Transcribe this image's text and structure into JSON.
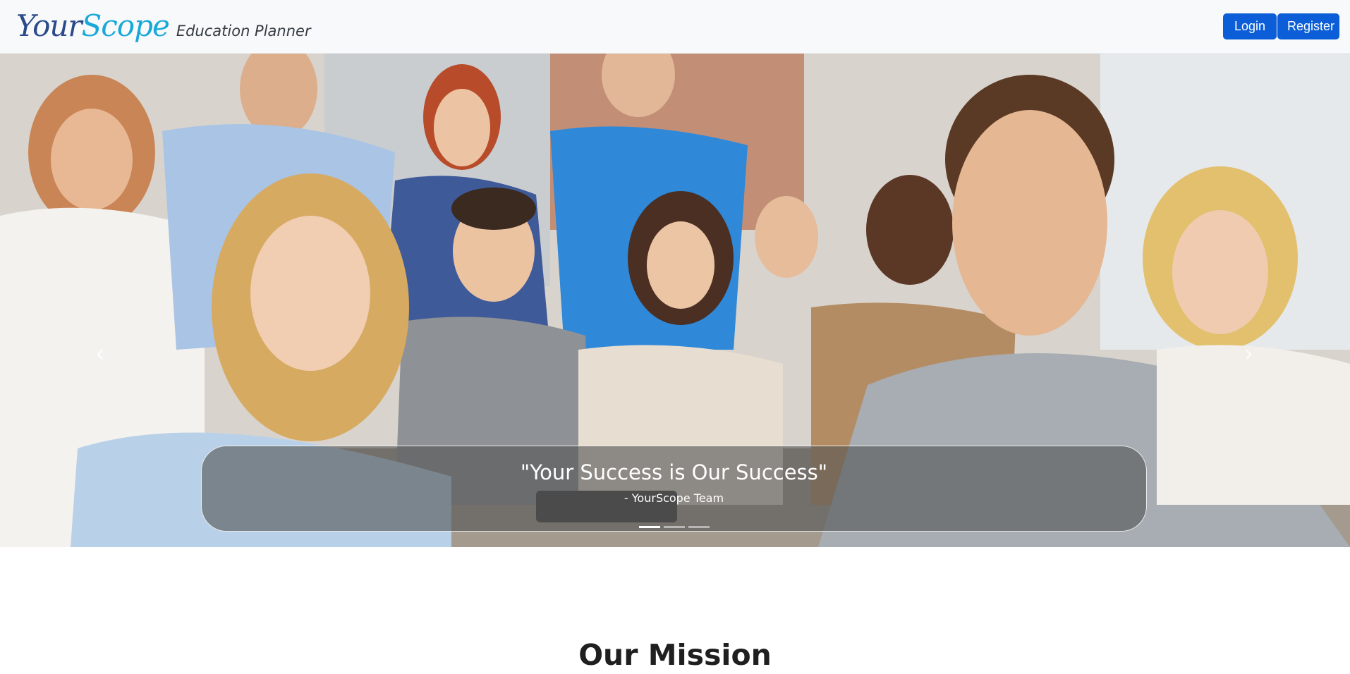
{
  "navbar": {
    "logo_your": "Your",
    "logo_scope": "Scope",
    "tagline": "Education Planner",
    "login_label": "Login",
    "register_label": "Register",
    "button_color": "#0b5ed7"
  },
  "carousel": {
    "prev_icon": "chevron-left-icon",
    "next_icon": "chevron-right-icon",
    "slide_image": "group of smiling students giving thumbs up",
    "quote": "\"Your Success is Our Success\"",
    "attribution": "- YourScope Team",
    "indicator_count": 3,
    "active_indicator": 1
  },
  "mission": {
    "heading": "Our Mission"
  }
}
